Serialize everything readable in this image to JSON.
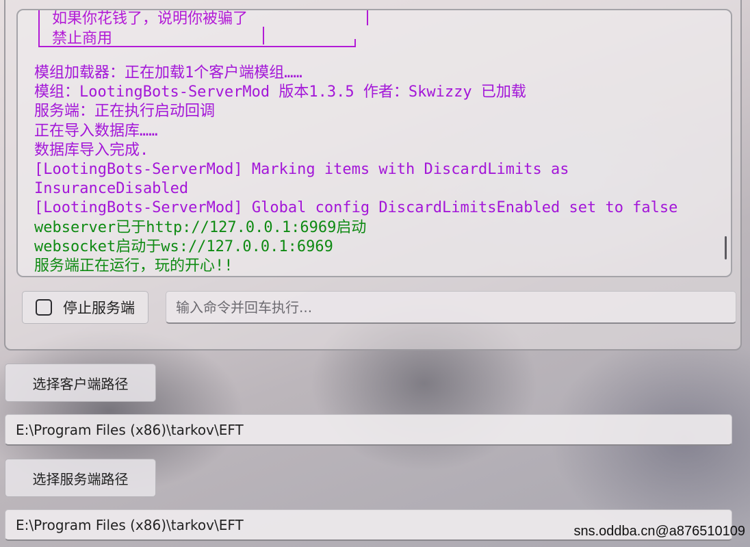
{
  "console": {
    "banner": [
      "如果你花钱了，说明你被骗了",
      "禁止商用"
    ],
    "log": [
      {
        "text": "模组加载器：正在加载1个客户端模组……",
        "color": "purple"
      },
      {
        "text": "模组：LootingBots-ServerMod 版本1.3.5 作者：Skwizzy 已加载",
        "color": "purple"
      },
      {
        "text": "服务端：正在执行启动回调",
        "color": "purple"
      },
      {
        "text": "正在导入数据库……",
        "color": "purple"
      },
      {
        "text": "数据库导入完成.",
        "color": "purple"
      },
      {
        "text": "[LootingBots-ServerMod] Marking items with DiscardLimits as",
        "color": "purple"
      },
      {
        "text": "InsuranceDisabled",
        "color": "purple"
      },
      {
        "text": "[LootingBots-ServerMod] Global config DiscardLimitsEnabled set to false",
        "color": "purple"
      },
      {
        "text": "webserver已于http://127.0.0.1:6969启动",
        "color": "green"
      },
      {
        "text": "websocket启动于ws://127.0.0.1:6969",
        "color": "green"
      },
      {
        "text": "服务端正在运行，玩的开心!!",
        "color": "green"
      }
    ],
    "colors": {
      "purple": "#a316d8",
      "green": "#0e8a12"
    }
  },
  "controls": {
    "stop_server_label": "停止服务端",
    "stop_server_checked": false,
    "command_placeholder": "输入命令并回车执行..."
  },
  "paths": {
    "client_button": "选择客户端路径",
    "client_path": "E:\\Program Files (x86)\\tarkov\\EFT",
    "server_button": "选择服务端路径",
    "server_path": "E:\\Program Files (x86)\\tarkov\\EFT"
  },
  "watermark": "sns.oddba.cn@a876510109"
}
